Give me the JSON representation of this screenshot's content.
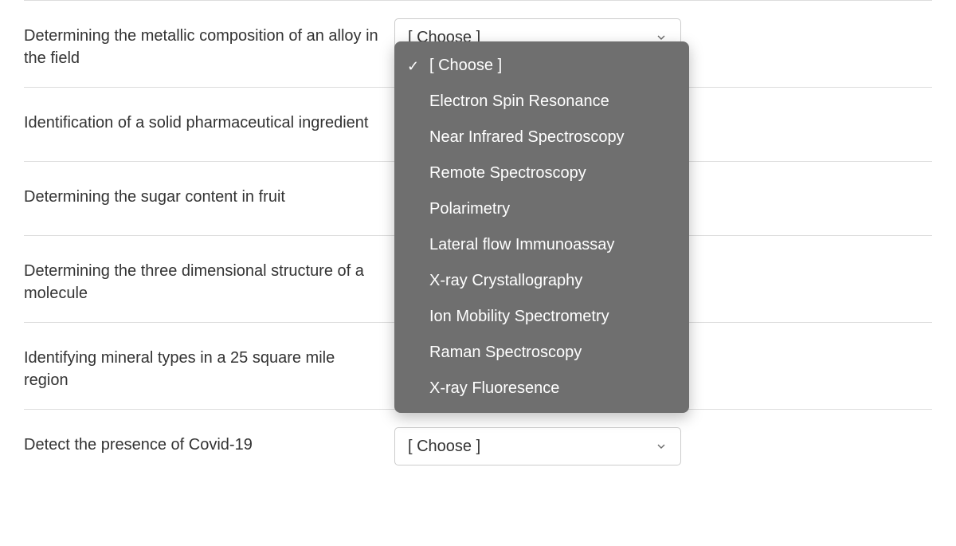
{
  "dropdown_placeholder": "[ Choose ]",
  "questions": [
    {
      "prompt": "Determining the metallic composition of an alloy in the field"
    },
    {
      "prompt": "Identification of a solid pharmaceutical ingredient"
    },
    {
      "prompt": "Determining the sugar content in fruit"
    },
    {
      "prompt": "Determining the three dimensional structure of a molecule"
    },
    {
      "prompt": "Identifying mineral types in a 25 square mile region"
    },
    {
      "prompt": "Detect the presence of Covid-19"
    }
  ],
  "menu": {
    "options": [
      "[ Choose ]",
      "Electron Spin Resonance",
      "Near Infrared Spectroscopy",
      "Remote Spectroscopy",
      "Polarimetry",
      "Lateral flow Immunoassay",
      "X-ray Crystallography",
      "Ion Mobility Spectrometry",
      "Raman Spectroscopy",
      "X-ray Fluoresence"
    ],
    "selected_index": 0
  }
}
